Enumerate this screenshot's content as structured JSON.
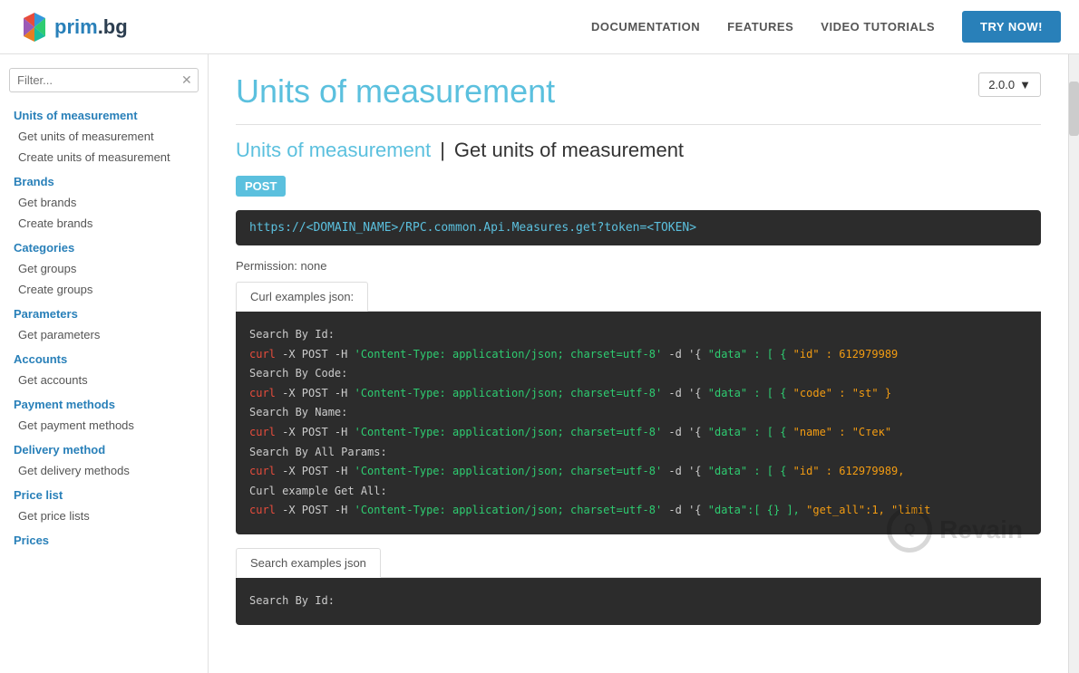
{
  "header": {
    "logo_text": "prim.bg",
    "nav": {
      "documentation": "DOCUMENTATION",
      "features": "FEATURES",
      "video_tutorials": "VIDEO TUTORIALS",
      "try_now": "TRY NOW!"
    }
  },
  "sidebar": {
    "filter_placeholder": "Filter...",
    "sections": [
      {
        "id": "units",
        "title": "Units of measurement",
        "items": [
          {
            "id": "get-units",
            "label": "Get units of measurement"
          },
          {
            "id": "create-units",
            "label": "Create units of measurement"
          }
        ]
      },
      {
        "id": "brands",
        "title": "Brands",
        "items": [
          {
            "id": "get-brands",
            "label": "Get brands"
          },
          {
            "id": "create-brands",
            "label": "Create brands"
          }
        ]
      },
      {
        "id": "categories",
        "title": "Categories",
        "items": [
          {
            "id": "get-groups",
            "label": "Get groups"
          },
          {
            "id": "create-groups",
            "label": "Create groups"
          }
        ]
      },
      {
        "id": "parameters",
        "title": "Parameters",
        "items": [
          {
            "id": "get-parameters",
            "label": "Get parameters"
          }
        ]
      },
      {
        "id": "accounts",
        "title": "Accounts",
        "items": [
          {
            "id": "get-accounts",
            "label": "Get accounts"
          }
        ]
      },
      {
        "id": "payment-methods",
        "title": "Payment methods",
        "items": [
          {
            "id": "get-payment-methods",
            "label": "Get payment methods"
          }
        ]
      },
      {
        "id": "delivery-method",
        "title": "Delivery method",
        "items": [
          {
            "id": "get-delivery-methods",
            "label": "Get delivery methods"
          }
        ]
      },
      {
        "id": "price-list",
        "title": "Price list",
        "items": [
          {
            "id": "get-price-lists",
            "label": "Get price lists"
          }
        ]
      },
      {
        "id": "prices",
        "title": "Prices",
        "items": []
      }
    ]
  },
  "content": {
    "page_title": "Units of measurement",
    "section_title_link": "Units of measurement",
    "section_title_separator": "|",
    "section_title_rest": "Get units of measurement",
    "version": "2.0.0",
    "version_arrow": "▼",
    "method": "POST",
    "url": "https://<DOMAIN_NAME>/RPC.common.Api.Measures.get?token=<TOKEN>",
    "permission": "Permission: none",
    "tab_curl": "Curl examples json:",
    "code_lines": [
      {
        "label": "Search By Id:",
        "cmd": "",
        "str": "",
        "key": ""
      },
      {
        "label": "curl",
        "cmd": " -X POST -H 'Content-Type: application/json; charset=utf-8' -d '{",
        "str": "  \"data\" : [    {",
        "key": "        \"id\" : 612979989"
      },
      {
        "label": "Search By Code:",
        "cmd": "",
        "str": "",
        "key": ""
      },
      {
        "label": "curl",
        "cmd": " -X POST -H 'Content-Type: application/json; charset=utf-8' -d '{",
        "str": "  \"data\" : [    {",
        "key": "        \"code\" : \"st\"  }"
      },
      {
        "label": "Search By Name:",
        "cmd": "",
        "str": "",
        "key": ""
      },
      {
        "label": "curl",
        "cmd": " -X POST -H 'Content-Type: application/json; charset=utf-8' -d '{",
        "str": "  \"data\" : [    {",
        "key": "        \"name\" : \"Стек\""
      },
      {
        "label": "Search By All Params:",
        "cmd": "",
        "str": "",
        "key": ""
      },
      {
        "label": "curl",
        "cmd": " -X POST -H 'Content-Type: application/json; charset=utf-8' -d '{",
        "str": "  \"data\" : [    {",
        "key": "        \"id\" : 612979989,"
      },
      {
        "label": "Curl example Get All:",
        "cmd": "",
        "str": "",
        "key": ""
      },
      {
        "label": "curl",
        "cmd": " -X POST -H 'Content-Type: application/json; charset=utf-8' -d '{",
        "str": "  \"data\":[    {} ],",
        "key": " \"get_all\":1,   \"limit"
      }
    ],
    "search_tab": "Search examples json",
    "search_code_label": "Search By Id:"
  }
}
